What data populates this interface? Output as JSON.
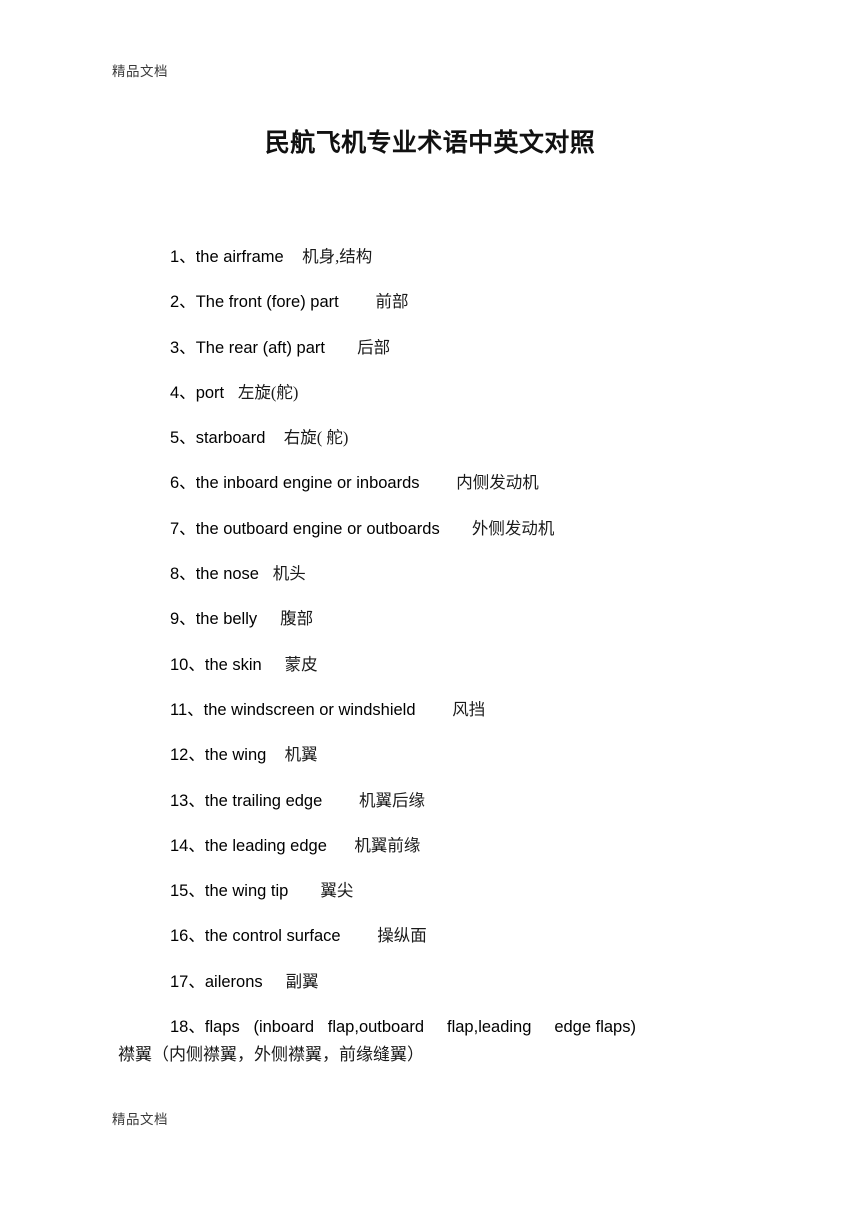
{
  "document": {
    "title": "民航飞机专业术语中英文对照",
    "header_mark": "精品文档",
    "footer_mark": "精品文档",
    "page_background": "#ffffff",
    "text_color": "#000000"
  },
  "terms": [
    {
      "num": "1、",
      "en": "the airframe",
      "gap": "    ",
      "zh": "机身,结构"
    },
    {
      "num": "2、",
      "en": "The front (fore) part",
      "gap": "        ",
      "zh": "前部"
    },
    {
      "num": "3、",
      "en": "The rear (aft) part",
      "gap": "       ",
      "zh": "后部"
    },
    {
      "num": "4、",
      "en": "port",
      "gap": "   ",
      "zh": "左旋(舵)"
    },
    {
      "num": "5、",
      "en": "starboard",
      "gap": "    ",
      "zh": "右旋( 舵)"
    },
    {
      "num": "6、",
      "en": "the inboard engine or inboards",
      "gap": "        ",
      "zh": "内侧发动机"
    },
    {
      "num": "7、",
      "en": "the outboard engine or outboards",
      "gap": "       ",
      "zh": "外侧发动机"
    },
    {
      "num": "8、",
      "en": "the nose",
      "gap": "   ",
      "zh": "机头"
    },
    {
      "num": "9、",
      "en": "the belly",
      "gap": "     ",
      "zh": "腹部"
    },
    {
      "num": "10、",
      "en": "the skin",
      "gap": "     ",
      "zh": "蒙皮"
    },
    {
      "num": "11、",
      "en": "the windscreen or windshield",
      "gap": "        ",
      "zh": "风挡"
    },
    {
      "num": "12、",
      "en": "the wing",
      "gap": "    ",
      "zh": "机翼"
    },
    {
      "num": "13、",
      "en": "the trailing edge",
      "gap": "        ",
      "zh": "机翼后缘"
    },
    {
      "num": "14、",
      "en": "the leading edge",
      "gap": "      ",
      "zh": "机翼前缘"
    },
    {
      "num": "15、",
      "en": "the wing tip",
      "gap": "       ",
      "zh": "翼尖"
    },
    {
      "num": "16、",
      "en": "the control surface",
      "gap": "        ",
      "zh": "操纵面"
    },
    {
      "num": "17、",
      "en": "ailerons",
      "gap": "     ",
      "zh": "副翼"
    },
    {
      "num": "18、",
      "en": "flaps   (inboard   flap,outboard     flap,leading     edge flaps)",
      "gap": "",
      "zh": ""
    }
  ],
  "continuation": {
    "text": "襟翼（内侧襟翼，外侧襟翼，前缘缝翼）"
  }
}
